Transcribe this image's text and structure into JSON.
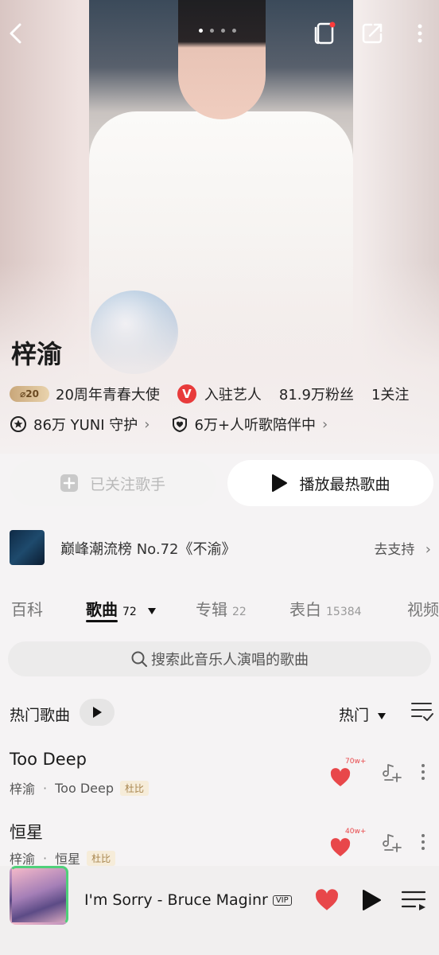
{
  "artist": {
    "name": "梓渝",
    "anniversary_badge": "20",
    "ambassador": "20周年青春大使",
    "verified_label": "入驻艺人",
    "fans": "81.9万粉丝",
    "following": "1关注",
    "guard": "86万 YUNI 守护",
    "listening": "6万+人听歌陪伴中"
  },
  "actions": {
    "follow": "已关注歌手",
    "play_hot": "播放最热歌曲"
  },
  "chart_banner": {
    "text": "巅峰潮流榜 No.72《不渝》",
    "link": "去支持"
  },
  "tabs": [
    {
      "label": "百科",
      "count": ""
    },
    {
      "label": "歌曲",
      "count": "72"
    },
    {
      "label": "专辑",
      "count": "22"
    },
    {
      "label": "表白",
      "count": "15384"
    },
    {
      "label": "视频",
      "count": ""
    }
  ],
  "search": {
    "placeholder": "搜索此音乐人演唱的歌曲"
  },
  "section": {
    "title": "热门歌曲",
    "sort": "热门"
  },
  "songs": [
    {
      "title": "Too Deep",
      "artist": "梓渝",
      "album": "Too Deep",
      "tag": "杜比",
      "likes": "70w+"
    },
    {
      "title": "恒星",
      "artist": "梓渝",
      "album": "恒星",
      "tag": "杜比",
      "likes": "40w+"
    }
  ],
  "player": {
    "title": "I'm Sorry - Bruce Maginr",
    "vip": "VIP"
  },
  "colors": {
    "accent_red": "#e8474a",
    "verified_red": "#e83b3b"
  }
}
